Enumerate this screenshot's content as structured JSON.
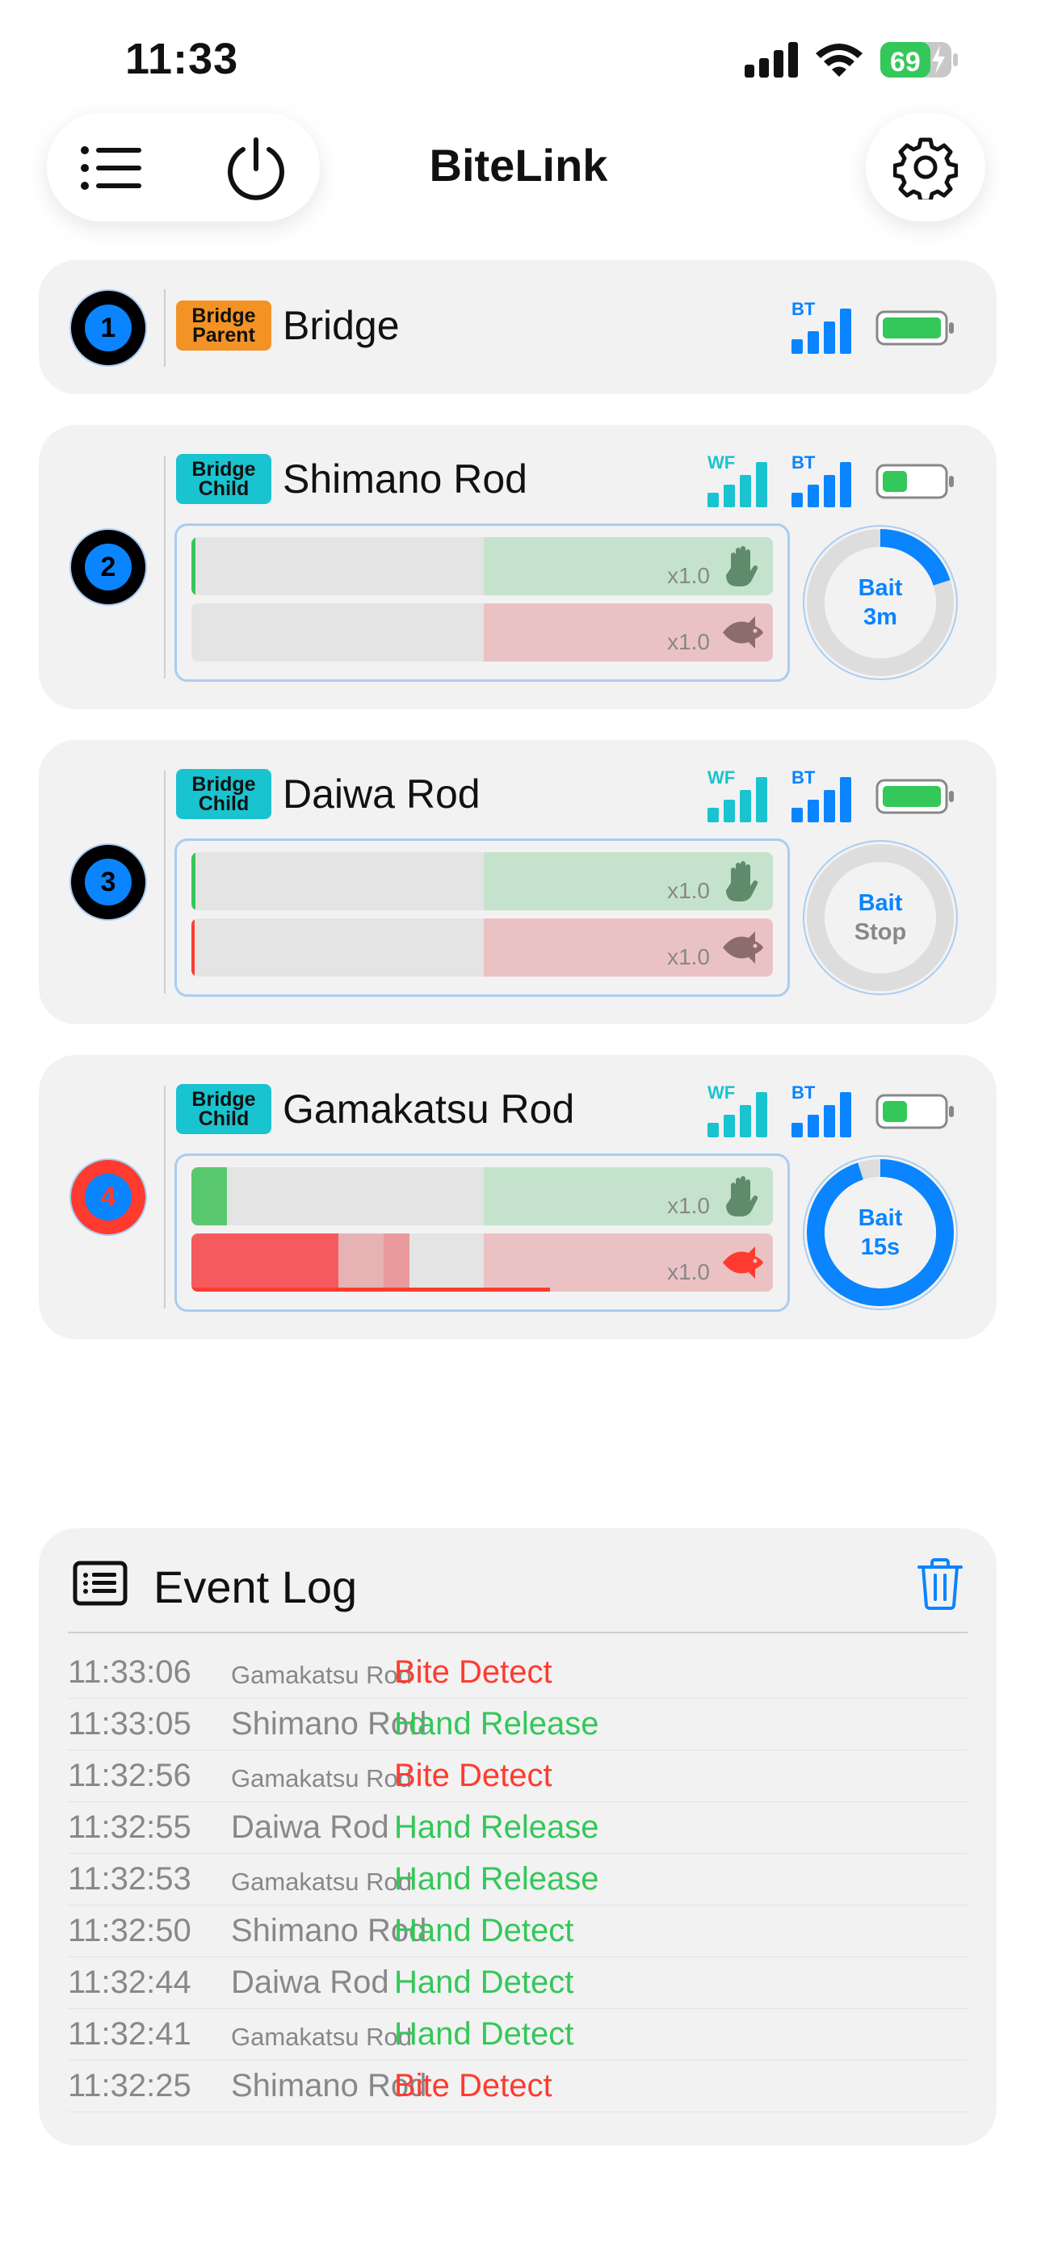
{
  "status_bar": {
    "time": "11:33",
    "battery": "69"
  },
  "app": {
    "title": "BiteLink"
  },
  "colors": {
    "accent": "#0a84ff",
    "green": "#34c759",
    "red": "#ff3b30",
    "tag_parent": "#f39326",
    "tag_child": "#19c3cf"
  },
  "devices": [
    {
      "number": "1",
      "role_line1": "Bridge",
      "role_line2": "Parent",
      "name": "Bridge",
      "signals": [
        "BT"
      ],
      "battery_level": 1.0
    },
    {
      "number": "2",
      "role_line1": "Bridge",
      "role_line2": "Child",
      "name": "Shimano Rod",
      "signals": [
        "WF",
        "BT"
      ],
      "battery_level": 0.4,
      "hand_multiplier": "x1.0",
      "bite_multiplier": "x1.0",
      "bait_line1": "Bait",
      "bait_line2": "3m",
      "bait_progress": 0.2
    },
    {
      "number": "3",
      "role_line1": "Bridge",
      "role_line2": "Child",
      "name": "Daiwa Rod",
      "signals": [
        "WF",
        "BT"
      ],
      "battery_level": 1.0,
      "hand_multiplier": "x1.0",
      "bite_multiplier": "x1.0",
      "bait_line1": "Bait",
      "bait_line2": "Stop",
      "bait_progress": 0
    },
    {
      "number": "4",
      "role_line1": "Bridge",
      "role_line2": "Child",
      "name": "Gamakatsu Rod",
      "signals": [
        "WF",
        "BT"
      ],
      "battery_level": 0.4,
      "hand_multiplier": "x1.0",
      "bite_multiplier": "x1.0",
      "bait_line1": "Bait",
      "bait_line2": "15s",
      "bait_progress": 0.95
    }
  ],
  "event_log": {
    "title": "Event Log",
    "entries": [
      {
        "time": "11:33:06",
        "source": "Gamakatsu Rod",
        "event": "Bite Detect",
        "color": "#ff3b30"
      },
      {
        "time": "11:33:05",
        "source": "Shimano Rod",
        "event": "Hand Release",
        "color": "#34c759"
      },
      {
        "time": "11:32:56",
        "source": "Gamakatsu Rod",
        "event": "Bite Detect",
        "color": "#ff3b30"
      },
      {
        "time": "11:32:55",
        "source": "Daiwa Rod",
        "event": "Hand Release",
        "color": "#34c759"
      },
      {
        "time": "11:32:53",
        "source": "Gamakatsu Rod",
        "event": "Hand Release",
        "color": "#34c759"
      },
      {
        "time": "11:32:50",
        "source": "Shimano Rod",
        "event": "Hand Detect",
        "color": "#34c759"
      },
      {
        "time": "11:32:44",
        "source": "Daiwa Rod",
        "event": "Hand Detect",
        "color": "#34c759"
      },
      {
        "time": "11:32:41",
        "source": "Gamakatsu Rod",
        "event": "Hand Detect",
        "color": "#34c759"
      },
      {
        "time": "11:32:25",
        "source": "Shimano Rod",
        "event": "Bite Detect",
        "color": "#ff3b30"
      }
    ]
  }
}
